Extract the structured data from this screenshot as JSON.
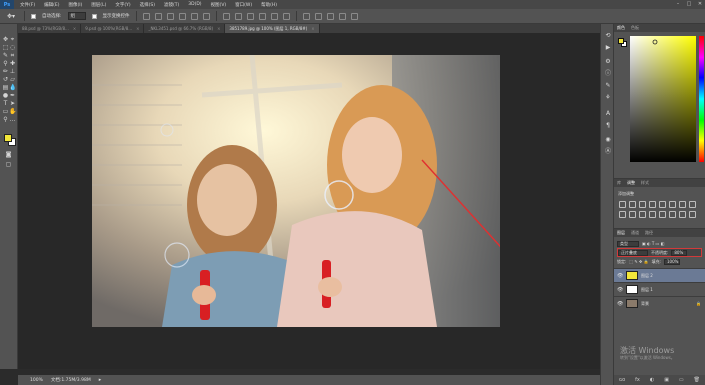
{
  "app": {
    "logo": "Ps"
  },
  "menu": [
    "文件(F)",
    "编辑(E)",
    "图像(I)",
    "图层(L)",
    "文字(Y)",
    "选择(S)",
    "滤镜(T)",
    "3D(D)",
    "视图(V)",
    "窗口(W)",
    "帮助(H)"
  ],
  "window_controls": [
    "–",
    "□",
    "✕"
  ],
  "options": {
    "auto_select_label": "自动选择:",
    "auto_select_value": "组",
    "show_transform_label": "显示变换控件"
  },
  "tabs": [
    {
      "label": "88.psd @ 73%(RGB/8...",
      "close": "×"
    },
    {
      "label": "9.psd @ 100%(RGB/8...",
      "close": "×"
    },
    {
      "label": "_NKL3451.psd @ 66.7% (RGB/8)",
      "close": "×"
    },
    {
      "label": "3851789.jpg @ 100% (图层 1, RGB/8#)",
      "close": "×"
    }
  ],
  "color_panel": {
    "tabs": [
      "颜色",
      "色板"
    ]
  },
  "adjustments": {
    "tabs": [
      "库",
      "调整",
      "样式"
    ],
    "title": "添加调整"
  },
  "layers": {
    "tabs": [
      "图层",
      "通道",
      "路径"
    ],
    "kind_label": "类型",
    "blend_mode": "正片叠底",
    "opacity_label": "不透明度:",
    "opacity_value": "80%",
    "lock_label": "锁定:",
    "fill_label": "填充:",
    "fill_value": "100%",
    "rows": [
      {
        "name": "图层 2",
        "selected": true,
        "thumb_color": "#f3e73a"
      },
      {
        "name": "图层 1",
        "selected": false,
        "thumb_color": "#ffffff"
      },
      {
        "name": "背景",
        "selected": false,
        "thumb_color": "#8a7a6a"
      }
    ],
    "footer": [
      "ɢᴏ",
      "fx",
      "◐",
      "▣",
      "▭",
      "🗑"
    ]
  },
  "status": {
    "zoom": "100%",
    "doc": "文档:1.75M/3.98M"
  },
  "watermark": {
    "title": "激活 Windows",
    "subtitle": "转到\"设置\"以激活 Windows。"
  },
  "colors": {
    "foreground": "#f3e73a",
    "background": "#ffffff",
    "annotation_arrow": "#e03030"
  }
}
